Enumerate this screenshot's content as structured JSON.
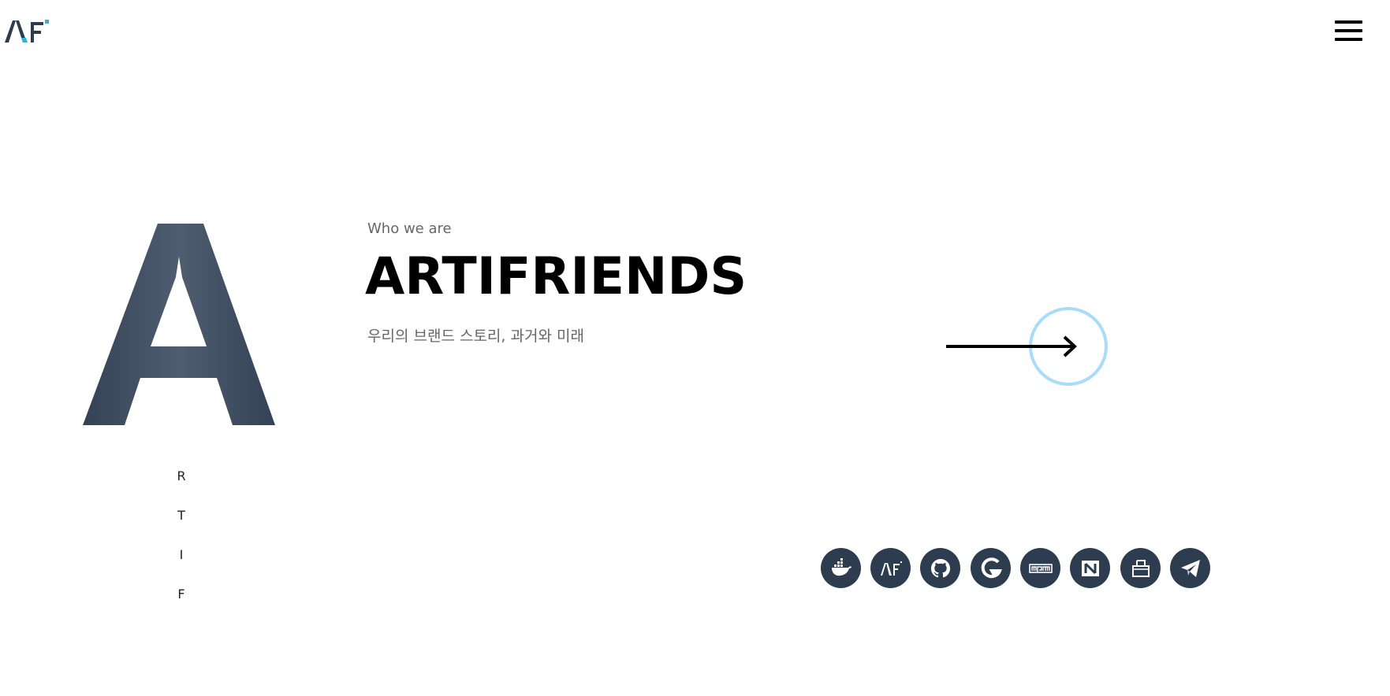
{
  "logo": {
    "alt": "AF"
  },
  "hero": {
    "big_letter": "A",
    "vertical_letters": [
      "R",
      "T",
      "I",
      "F"
    ],
    "kicker": "Who we are",
    "title": "ARTIFRIENDS",
    "subtitle": "우리의 브랜드 스토리, 과거와 미래"
  },
  "cta": {
    "icon": "arrow-right-icon",
    "ring_color": "#a8dcf8"
  },
  "social": [
    {
      "name": "docker",
      "icon": "docker-icon"
    },
    {
      "name": "artifriends",
      "icon": "af-logo-icon"
    },
    {
      "name": "github",
      "icon": "github-icon"
    },
    {
      "name": "gitkraken",
      "icon": "g-logo-icon"
    },
    {
      "name": "npm",
      "icon": "npm-icon"
    },
    {
      "name": "notion",
      "icon": "notion-icon"
    },
    {
      "name": "docs",
      "icon": "document-icon"
    },
    {
      "name": "telegram",
      "icon": "telegram-icon"
    }
  ],
  "colors": {
    "brand_dark": "#2d3d4f",
    "brand_accent": "#25b6e6",
    "letter_fill": "#3c4b5e"
  }
}
